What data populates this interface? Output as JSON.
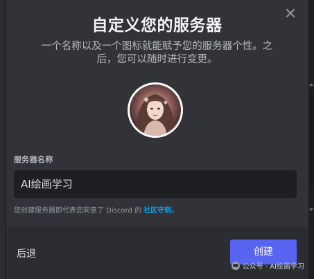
{
  "dialog": {
    "title": "自定义您的服务器",
    "subtitle_line1": "一个名称以及一个图标就能赋予您的服务器个性。之",
    "subtitle_line2": "后，您可以随时进行变更。",
    "close_icon": "close-icon"
  },
  "avatar": {
    "icon": "server-avatar-image"
  },
  "name_field": {
    "label": "服务器名称",
    "value": "AI绘画学习"
  },
  "terms": {
    "text": "您创建服务器即代表您同意了 Discord 的",
    "link": "社区守则",
    "suffix": "。"
  },
  "footer": {
    "back_label": "后退",
    "create_label": "创建"
  },
  "watermark": {
    "text": "公众号 · AI绘画学习",
    "icon": "wechat-icon"
  },
  "colors": {
    "accent": "#5865f2",
    "link": "#00a8fc",
    "background": "#313338"
  }
}
